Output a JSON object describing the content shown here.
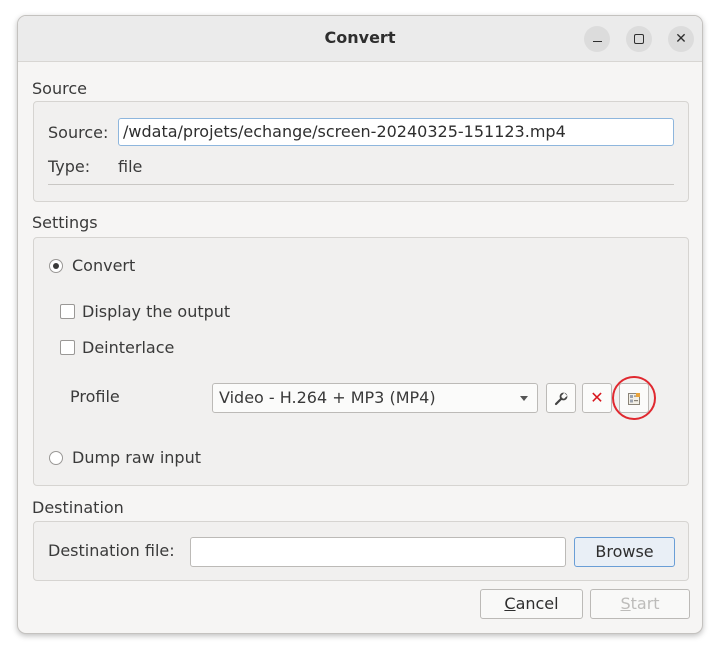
{
  "window": {
    "title": "Convert",
    "controls": {
      "minimize": "minimize-icon",
      "maximize": "maximize-icon",
      "close": "close-icon"
    }
  },
  "source": {
    "section_label": "Source",
    "source_label": "Source:",
    "source_value": "/wdata/projets/echange/screen-20240325-151123.mp4",
    "type_label": "Type:",
    "type_value": "file"
  },
  "settings": {
    "section_label": "Settings",
    "convert_label": "Convert",
    "convert_selected": true,
    "display_output_label": "Display the output",
    "display_output_checked": false,
    "deinterlace_label": "Deinterlace",
    "deinterlace_checked": false,
    "profile_label": "Profile",
    "profile_selected": "Video - H.264 + MP3 (MP4)",
    "profile_buttons": [
      "wrench-icon",
      "delete-icon",
      "new-profile-icon"
    ],
    "dump_raw_label": "Dump raw input",
    "dump_raw_selected": false
  },
  "destination": {
    "section_label": "Destination",
    "file_label": "Destination file:",
    "file_value": "",
    "browse_label": "Browse"
  },
  "footer": {
    "cancel_prefix": "",
    "cancel_mnemonic": "C",
    "cancel_rest": "ancel",
    "start_mnemonic": "S",
    "start_rest": "tart"
  },
  "colors": {
    "highlight_circle": "#e0282f",
    "delete_icon": "#d8161d"
  }
}
